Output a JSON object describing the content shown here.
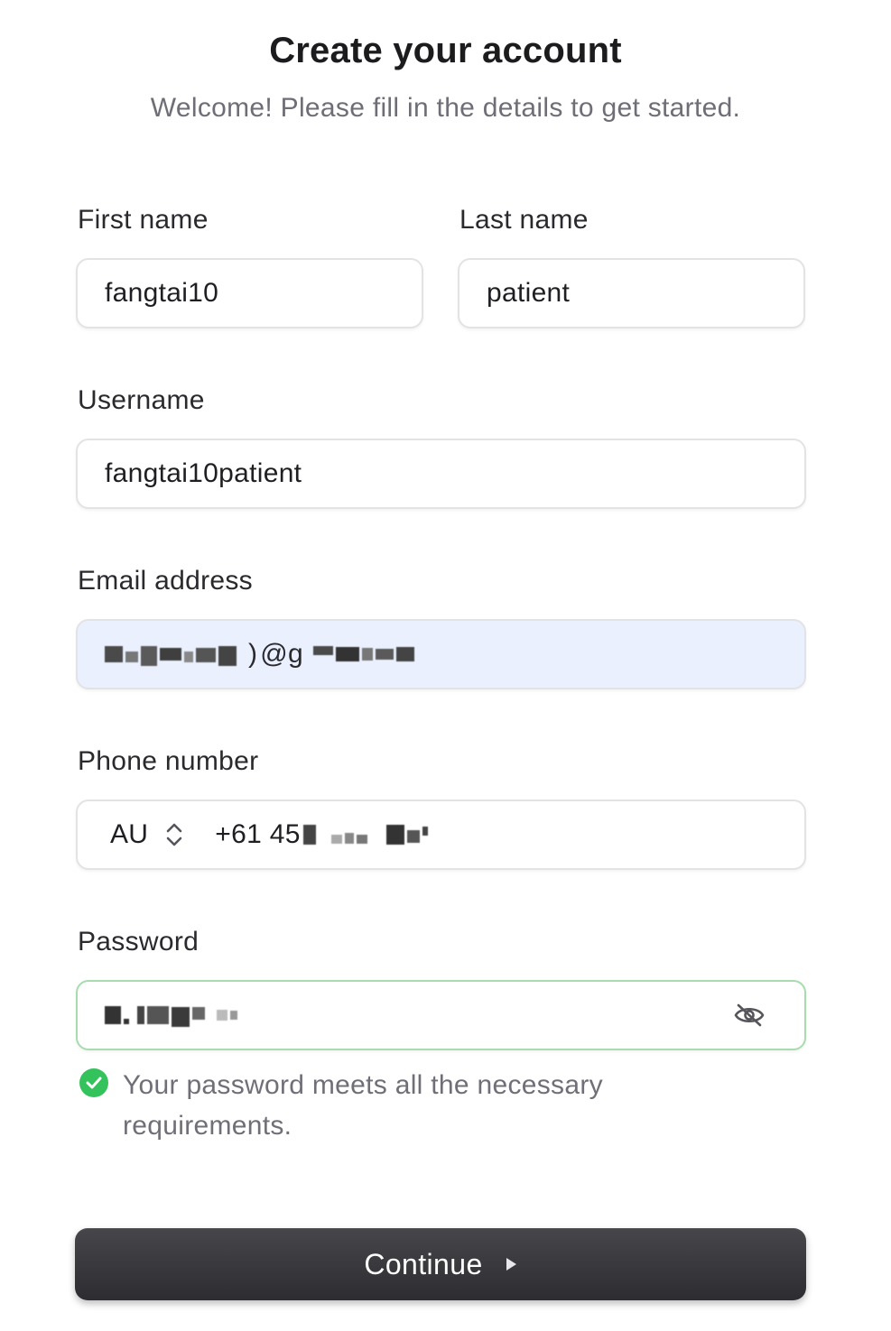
{
  "header": {
    "title": "Create your account",
    "subtitle": "Welcome! Please fill in the details to get started."
  },
  "form": {
    "first_name": {
      "label": "First name",
      "value": "fangtai10"
    },
    "last_name": {
      "label": "Last name",
      "value": "patient"
    },
    "username": {
      "label": "Username",
      "value": "fangtai10patient"
    },
    "email": {
      "label": "Email address",
      "value_visible_fragment": "@g",
      "redacted": true
    },
    "phone": {
      "label": "Phone number",
      "country": "AU",
      "value_visible_fragment": "+61 45",
      "redacted": true
    },
    "password": {
      "label": "Password",
      "redacted": true,
      "toggle_icon": "eye-slash-icon",
      "hint": "Your password meets all the necessary requirements.",
      "hint_icon": "check-circle-icon"
    }
  },
  "actions": {
    "continue_label": "Continue",
    "continue_icon": "play-arrow-icon"
  },
  "colors": {
    "primary_button": "#2d2d31",
    "success": "#34c25c",
    "autofill_bg": "#eaf0fd",
    "valid_border": "#a8dcae"
  }
}
